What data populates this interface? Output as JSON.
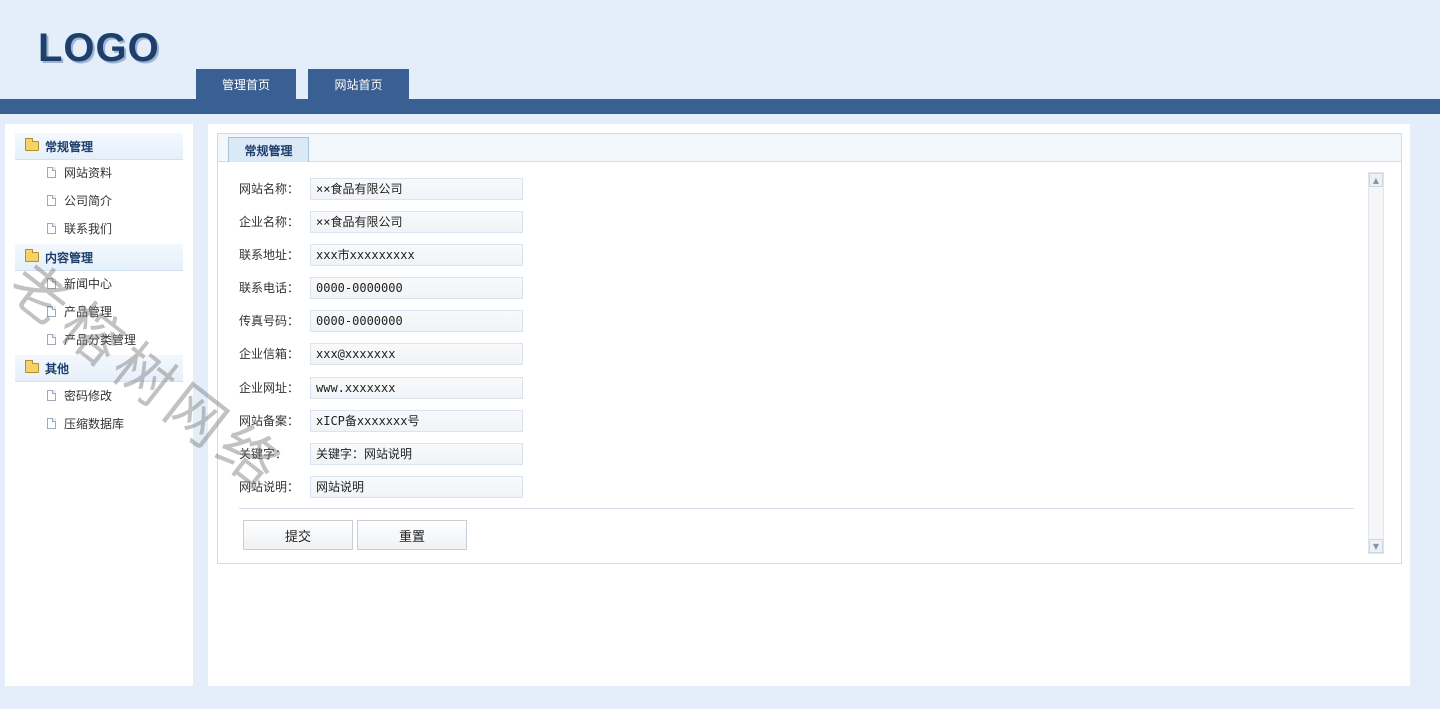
{
  "header": {
    "logo": "LOGO",
    "tabs": [
      {
        "label": "管理首页"
      },
      {
        "label": "网站首页"
      }
    ]
  },
  "sidebar": {
    "groups": [
      {
        "title": "常规管理",
        "items": [
          "网站资料",
          "公司简介",
          "联系我们"
        ]
      },
      {
        "title": "内容管理",
        "items": [
          "新闻中心",
          "产品管理",
          "产品分类管理"
        ]
      },
      {
        "title": "其他",
        "items": [
          "密码修改",
          "压缩数据库"
        ]
      }
    ]
  },
  "main": {
    "tab": "常规管理",
    "fields": [
      {
        "label": "网站名称：",
        "value": "××食品有限公司"
      },
      {
        "label": "企业名称：",
        "value": "××食品有限公司"
      },
      {
        "label": "联系地址：",
        "value": "xxx市xxxxxxxxx"
      },
      {
        "label": "联系电话：",
        "value": "0000-0000000"
      },
      {
        "label": "传真号码：",
        "value": "0000-0000000"
      },
      {
        "label": "企业信箱：",
        "value": "xxx@xxxxxxx"
      },
      {
        "label": "企业网址：",
        "value": "www.xxxxxxx"
      },
      {
        "label": "网站备案：",
        "value": "xICP备xxxxxxx号"
      },
      {
        "label": "关键字：",
        "value": "关键字：网站说明"
      },
      {
        "label": "网站说明：",
        "value": "网站说明"
      }
    ],
    "buttons": {
      "submit": "提交",
      "reset": "重置"
    }
  },
  "watermark": "老榕树网络"
}
